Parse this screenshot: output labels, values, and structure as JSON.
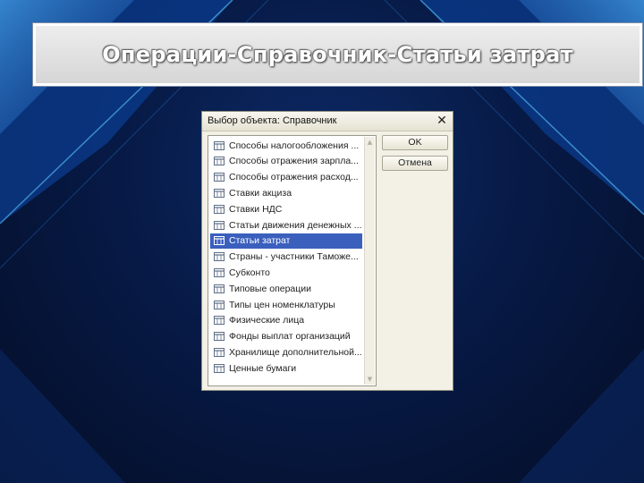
{
  "slide": {
    "title": "Операции-Справочник-Статьи затрат"
  },
  "dialog": {
    "title": "Выбор объекта: Справочник",
    "close_glyph": "✕",
    "ok_label": "OK",
    "cancel_label": "Отмена",
    "selected_index": 6,
    "items": [
      {
        "label": "Способы налогообложения ..."
      },
      {
        "label": "Способы отражения зарпла..."
      },
      {
        "label": "Способы отражения расход..."
      },
      {
        "label": "Ставки акциза"
      },
      {
        "label": "Ставки НДС"
      },
      {
        "label": "Статьи движения денежных ..."
      },
      {
        "label": "Статьи затрат"
      },
      {
        "label": "Страны - участники Таможе..."
      },
      {
        "label": "Субконто"
      },
      {
        "label": "Типовые операции"
      },
      {
        "label": "Типы цен номенклатуры"
      },
      {
        "label": "Физические лица"
      },
      {
        "label": "Фонды выплат организаций"
      },
      {
        "label": "Хранилище дополнительной..."
      },
      {
        "label": "Ценные бумаги"
      }
    ]
  },
  "colors": {
    "selection": "#3a5fbd",
    "icon": "#5f6f86"
  }
}
